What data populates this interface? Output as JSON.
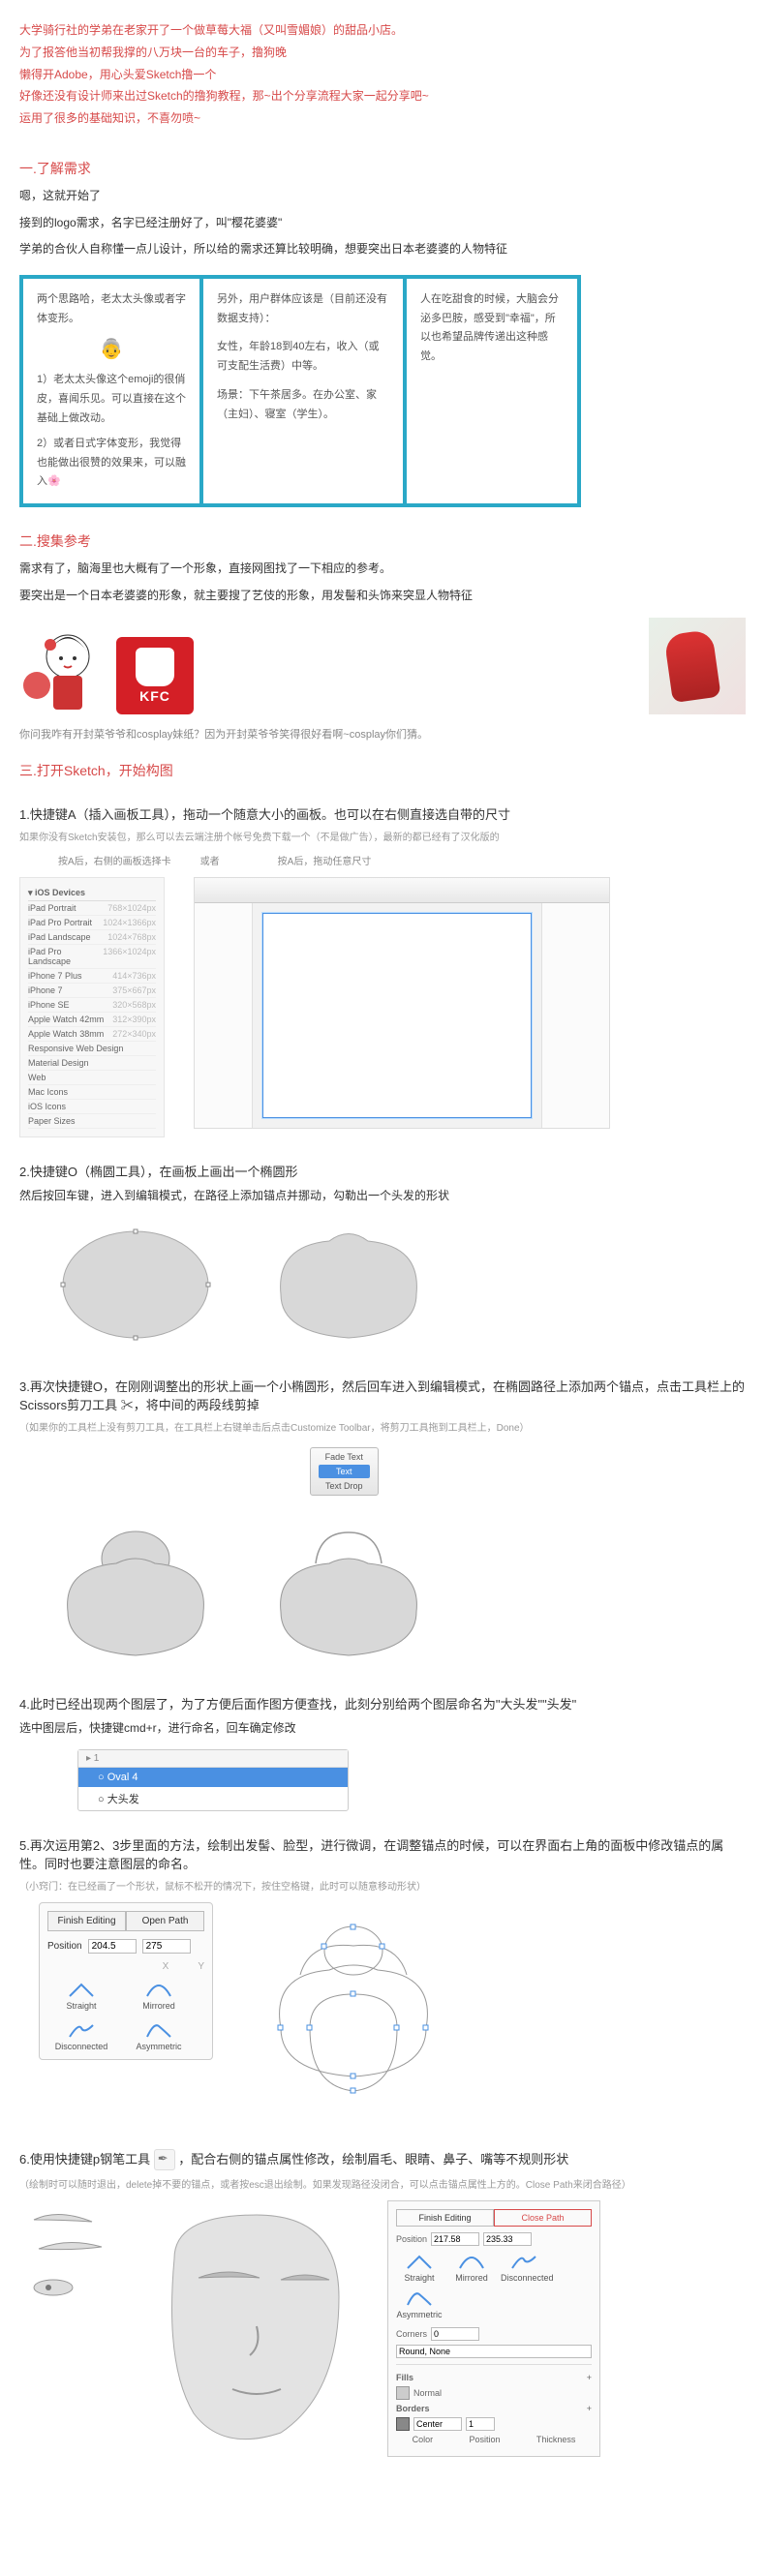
{
  "intro": {
    "l1": "大学骑行社的学弟在老家开了一个做草莓大福（又叫雪媚娘）的甜品小店。",
    "l2": "为了报答他当初帮我撑的八万块一台的车子，撸狗晚",
    "l3": "懒得开Adobe，用心头爱Sketch撸一个",
    "l4": "好像还没有设计师来出过Sketch的撸狗教程，那~出个分享流程大家一起分享吧~",
    "l5": "运用了很多的基础知识，不喜勿喷~"
  },
  "s1": {
    "title": "一.了解需求",
    "p1": "嗯，这就开始了",
    "p2": "接到的logo需求，名字已经注册好了，叫\"樱花婆婆\"",
    "p3": "学弟的合伙人自称懂一点儿设计，所以给的需求还算比较明确，想要突出日本老婆婆的人物特征",
    "box1": {
      "t": "两个思路哈，老太太头像或者字体变形。",
      "a": "1）老太太头像这个emoji的很俏皮，喜闻乐见。可以直接在这个基础上做改动。",
      "b": "2）或者日式字体变形，我觉得也能做出很赞的效果来，可以融入🌸"
    },
    "box2": {
      "t": "另外，用户群体应该是（目前还没有数据支持）：",
      "a": "女性，年龄18到40左右，收入（或可支配生活费）中等。",
      "b": "场景：下午茶居多。在办公室、家（主妇）、寝室（学生）。"
    },
    "box3": {
      "t": "人在吃甜食的时候，大脑会分泌多巴胺，感受到\"幸福\"，所以也希望品牌传递出这种感觉。"
    }
  },
  "s2": {
    "title": "二.搜集参考",
    "p1": "需求有了，脑海里也大概有了一个形象，直接网图找了一下相应的参考。",
    "p2": "要突出是一个日本老婆婆的形象，就主要搜了艺伎的形象，用发髻和头饰来突显人物特征",
    "kfc": "KFC",
    "note": "你问我咋有开封菜爷爷和cosplay妹纸？因为开封菜爷爷笑得很好看啊~cosplay你们猜。"
  },
  "s3": {
    "title": "三.打开Sketch，开始构图",
    "step1": "1.快捷键A（插入画板工具），拖动一个随意大小的画板。也可以在右侧直接选自带的尺寸",
    "hint1": "如果你没有Sketch安装包，那么可以去云端注册个帐号免费下载一个（不是做广告），最新的都已经有了汉化版的",
    "cap1a": "按A后，右侧的画板选择卡",
    "cap1b": "或者",
    "cap1c": "按A后，拖动任意尺寸",
    "sidebar": [
      [
        "iPad Portrait",
        "768×1024px"
      ],
      [
        "iPad Pro Portrait",
        "1024×1366px"
      ],
      [
        "iPad Landscape",
        "1024×768px"
      ],
      [
        "iPad Pro Landscape",
        "1366×1024px"
      ],
      [
        "iPhone 7 Plus",
        "414×736px"
      ],
      [
        "iPhone 7",
        "375×667px"
      ],
      [
        "iPhone SE",
        "320×568px"
      ],
      [
        "Apple Watch 42mm",
        "312×390px"
      ],
      [
        "Apple Watch 38mm",
        "272×340px"
      ],
      [
        "Responsive Web Design",
        ""
      ],
      [
        "Material Design",
        ""
      ],
      [
        "Web",
        ""
      ],
      [
        "Mac Icons",
        ""
      ],
      [
        "iOS Icons",
        ""
      ],
      [
        "Paper Sizes",
        ""
      ]
    ],
    "step2": "2.快捷键O（椭圆工具），在画板上画出一个椭圆形",
    "step2b": "然后按回车键，进入到编辑模式，在路径上添加锚点并挪动，勾勒出一个头发的形状",
    "step3": "3.再次快捷键O，在刚刚调整出的形状上画一个小椭圆形，然后回车进入到编辑模式，在椭圆路径上添加两个锚点，点击工具栏上的Scissors剪刀工具 ✂，将中间的两段线剪掉",
    "hint3": "（如果你的工具栏上没有剪刀工具，在工具栏上右键单击后点击Customize Toolbar，将剪刀工具拖到工具栏上，Done）",
    "toolbar_items": [
      "Fade Text",
      "Text",
      "Text Drop"
    ],
    "toolbar_label": "Customize Toolbar 将剪刀工具拖到工具栏上，Done）",
    "step4": "4.此时已经出现两个图层了，为了方便后面作图方便查找，此刻分别给两个图层命名为\"大头发\"\"头发\"",
    "step4b": "选中图层后，快捷键cmd+r，进行命名，回车确定修改",
    "layer_hdr": "▸ 1",
    "layer_sel": "○  Oval 4",
    "layer_item": "○  大头发",
    "step5": "5.再次运用第2、3步里面的方法，绘制出发髻、脸型，进行微调，在调整锚点的时候，可以在界面右上角的面板中修改锚点的属性。同时也要注意图层的命名。",
    "hint5": "（小窍门：在已经画了一个形状，鼠标不松开的情况下，按住空格键，此时可以随意移动形状）",
    "panel5": {
      "btn1": "Finish Editing",
      "btn2": "Open Path",
      "pos": "Position",
      "x": "204.5",
      "y": "275",
      "xs": "X",
      "ys": "Y",
      "types": [
        "Straight",
        "Mirrored",
        "Disconnected",
        "Asymmetric"
      ]
    },
    "step6_pre": "6.使用快捷键p钢笔工具 ",
    "step6_post": " ，配合右侧的锚点属性修改，绘制眉毛、眼睛、鼻子、嘴等不规则形状",
    "hint6": "（绘制时可以随时退出，delete掉不要的锚点，或者按esc退出绘制。如果发现路径没闭合，可以点击锚点属性上方的。Close Path来闭合路径）",
    "panel6": {
      "h1": "Finish Editing",
      "h2": "Close Path",
      "pos": "Position",
      "x": "217.58",
      "y": "235.33",
      "types": [
        "Straight",
        "Mirrored",
        "Disconnected",
        "Asymmetric"
      ],
      "corners": "Corners",
      "round": "Round, None",
      "sections": [
        "Fills",
        "Borders"
      ],
      "normal": "Normal",
      "color": "Color",
      "position": "Position",
      "thickness": "Thickness"
    }
  }
}
